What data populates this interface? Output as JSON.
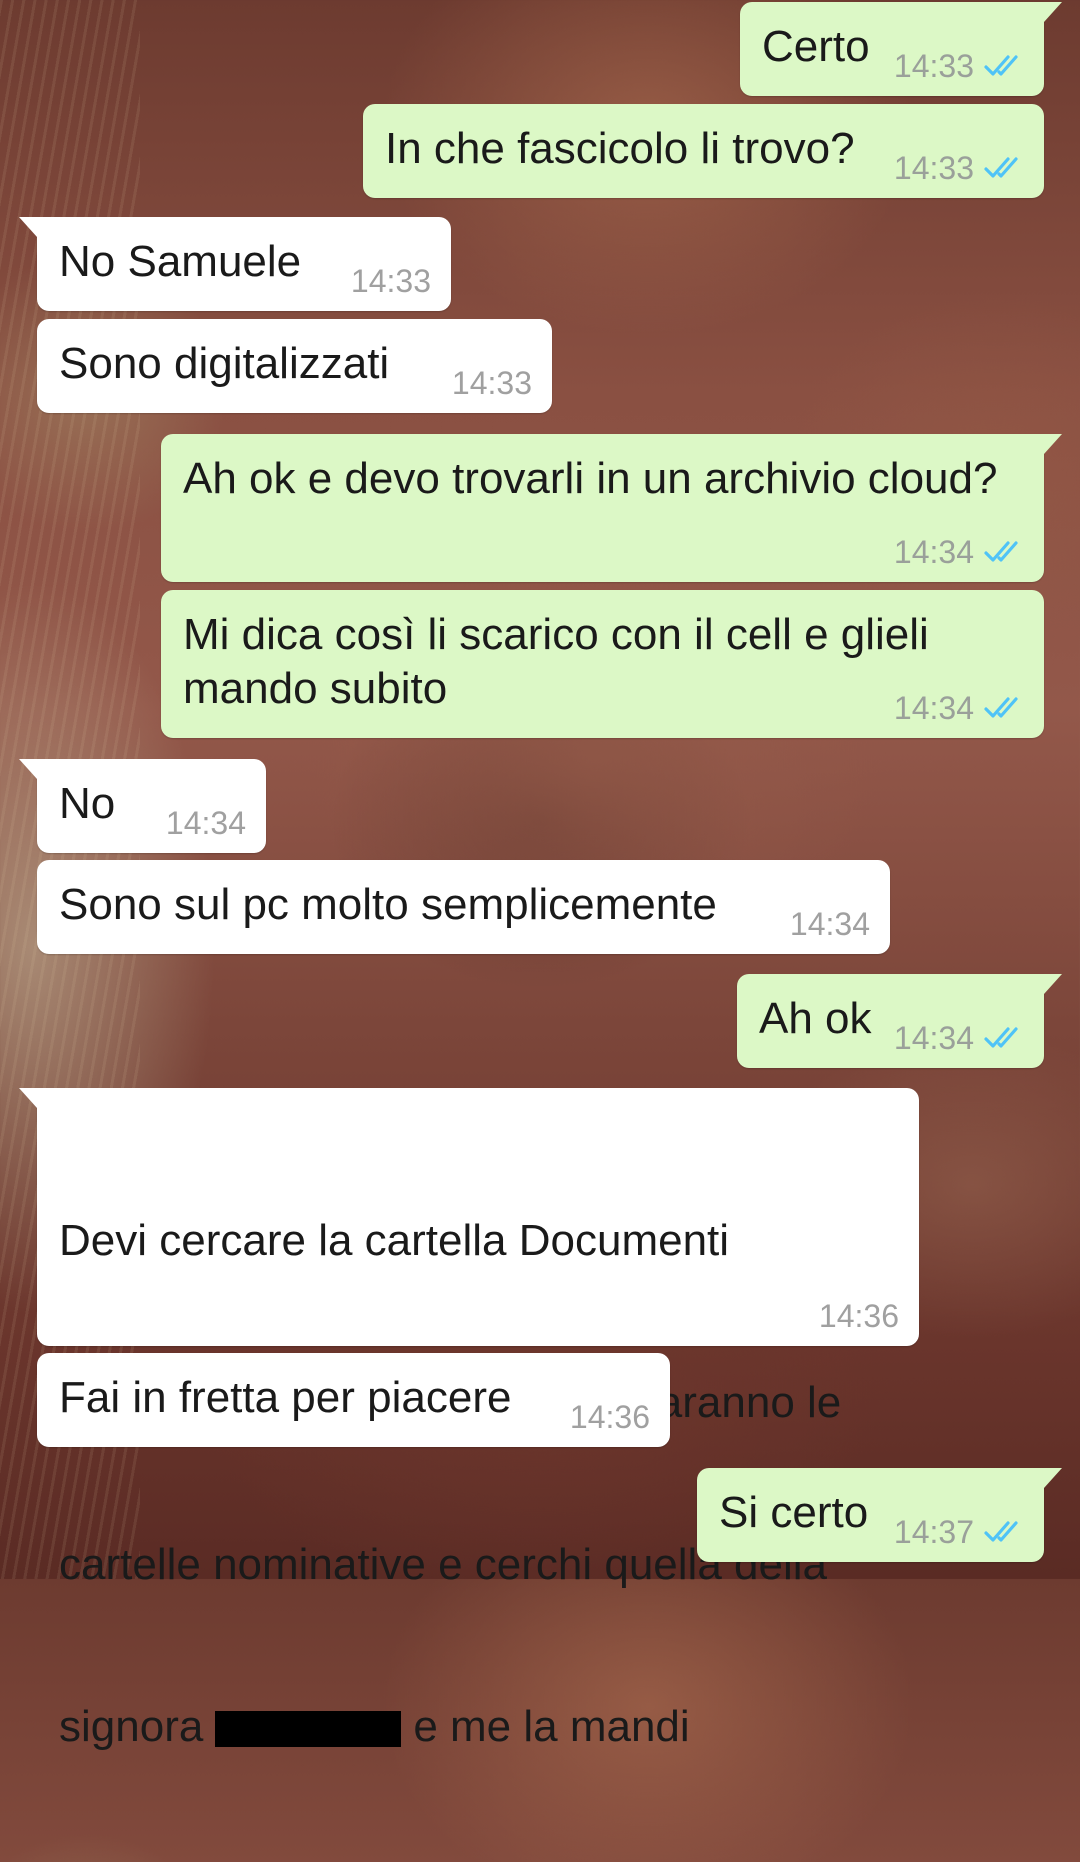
{
  "conversation": {
    "messages": [
      {
        "dir": "out",
        "text": "Certo",
        "time": "14:33",
        "read_tick_color": "#4fc3f7"
      },
      {
        "dir": "out",
        "text": "In che fascicolo li trovo?",
        "time": "14:33",
        "read_tick_color": "#4fc3f7"
      },
      {
        "dir": "in",
        "text": "No Samuele",
        "time": "14:33"
      },
      {
        "dir": "in",
        "text": "Sono digitalizzati",
        "time": "14:33"
      },
      {
        "dir": "out",
        "text": "Ah ok e devo trovarli in un archivio cloud?",
        "time": "14:34",
        "read_tick_color": "#4fc3f7"
      },
      {
        "dir": "out",
        "text": "Mi dica così li scarico con il cell e glieli\nmando subito",
        "time": "14:34",
        "read_tick_color": "#4fc3f7"
      },
      {
        "dir": "in",
        "text": "No",
        "time": "14:34"
      },
      {
        "dir": "in",
        "text": "Sono sul pc molto semplicemente",
        "time": "14:34"
      },
      {
        "dir": "out",
        "text": "Ah ok",
        "time": "14:34",
        "read_tick_color": "#4fc3f7"
      },
      {
        "dir": "in",
        "text_line1": "Devi cercare la cartella Documenti",
        "text_line2": "Anno 2020-2021, poi ci saranno le",
        "text_line3": "cartelle nominative e cerchi quella della",
        "text_line4a": "signora",
        "text_line4b": "e me la mandi",
        "time": "14:36"
      },
      {
        "dir": "in",
        "text": "Fai in fretta per piacere",
        "time": "14:36"
      },
      {
        "dir": "out",
        "text": "Si certo",
        "time": "14:37",
        "read_tick_color": "#4fc3f7"
      }
    ]
  }
}
